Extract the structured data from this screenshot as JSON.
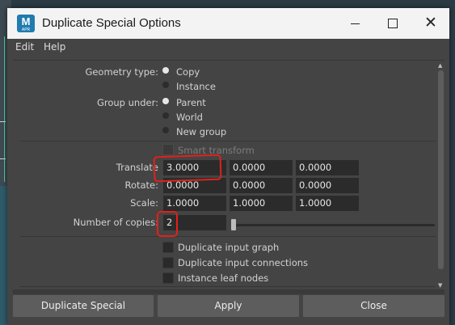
{
  "window": {
    "title": "Duplicate Special Options",
    "app_icon_letter": "M",
    "app_icon_sub": "APR"
  },
  "menu": [
    "Edit",
    "Help"
  ],
  "geometry_type": {
    "label": "Geometry type:",
    "options": [
      "Copy",
      "Instance"
    ],
    "selected": "Copy"
  },
  "group_under": {
    "label": "Group under:",
    "options": [
      "Parent",
      "World",
      "New group"
    ],
    "selected": "Parent"
  },
  "smart_transform": {
    "label": "Smart transform",
    "checked": false,
    "enabled": false
  },
  "translate": {
    "label": "Translate",
    "values": [
      "3.0000",
      "0.0000",
      "0.0000"
    ]
  },
  "rotate": {
    "label": "Rotate:",
    "values": [
      "0.0000",
      "0.0000",
      "0.0000"
    ]
  },
  "scale": {
    "label": "Scale:",
    "values": [
      "1.0000",
      "1.0000",
      "1.0000"
    ]
  },
  "copies": {
    "label": "Number of copies:",
    "value": "2",
    "slider_fraction": 0.0
  },
  "checkboxes": [
    {
      "label": "Duplicate input graph",
      "checked": false
    },
    {
      "label": "Duplicate input connections",
      "checked": false
    },
    {
      "label": "Instance leaf nodes",
      "checked": false
    }
  ],
  "buttons": {
    "duplicate": "Duplicate Special",
    "apply": "Apply",
    "close": "Close"
  },
  "colors": {
    "highlight": "#e0211b",
    "panel": "#444444",
    "field": "#2b2b2b"
  }
}
